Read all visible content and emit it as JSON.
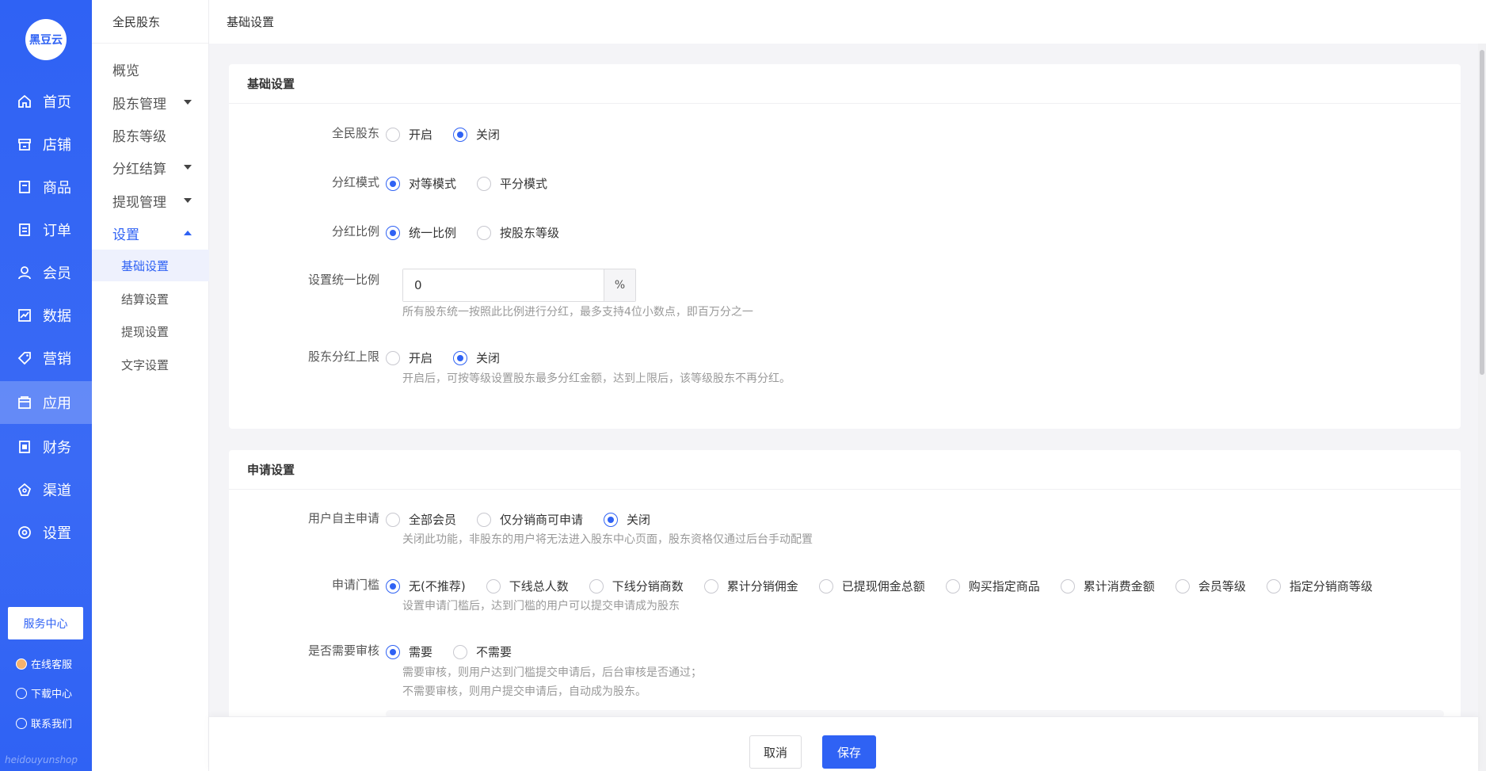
{
  "brand": {
    "logo_text": "黑豆云",
    "watermark": "heidouyunshop"
  },
  "nav": {
    "items": [
      {
        "label": "首页",
        "icon": "home-icon"
      },
      {
        "label": "店铺",
        "icon": "store-icon"
      },
      {
        "label": "商品",
        "icon": "goods-icon"
      },
      {
        "label": "订单",
        "icon": "order-icon"
      },
      {
        "label": "会员",
        "icon": "member-icon"
      },
      {
        "label": "数据",
        "icon": "chart-icon"
      },
      {
        "label": "营销",
        "icon": "tag-icon"
      },
      {
        "label": "应用",
        "icon": "app-icon"
      },
      {
        "label": "财务",
        "icon": "finance-icon"
      },
      {
        "label": "渠道",
        "icon": "channel-icon"
      },
      {
        "label": "设置",
        "icon": "gear-icon"
      }
    ],
    "active_index": 7,
    "service_button": "服务中心",
    "links": [
      "在线客服",
      "下载中心",
      "联系我们"
    ]
  },
  "subnav": {
    "title": "全民股东",
    "items": [
      "概览",
      "股东管理",
      "股东等级",
      "分红结算",
      "提现管理",
      "设置"
    ],
    "children": [
      "基础设置",
      "结算设置",
      "提现设置",
      "文字设置"
    ],
    "active_child": 0
  },
  "topbar": {
    "title": "基础设置"
  },
  "basic": {
    "title": "基础设置",
    "rows": {
      "shareholder": {
        "label": "全民股东",
        "options": [
          "开启",
          "关闭"
        ],
        "selected": 1
      },
      "bonus_mode": {
        "label": "分红模式",
        "options": [
          "对等模式",
          "平分模式"
        ],
        "selected": 0
      },
      "bonus_ratio": {
        "label": "分红比例",
        "options": [
          "统一比例",
          "按股东等级"
        ],
        "selected": 0
      },
      "uniform_ratio": {
        "label": "设置统一比例",
        "value": "0",
        "suffix": "%",
        "hint": "所有股东统一按照此比例进行分红，最多支持4位小数点，即百万分之一"
      },
      "bonus_cap": {
        "label": "股东分红上限",
        "options": [
          "开启",
          "关闭"
        ],
        "selected": 1,
        "hint": "开启后，可按等级设置股东最多分红金额，达到上限后，该等级股东不再分红。"
      }
    }
  },
  "apply": {
    "title": "申请设置",
    "rows": {
      "self_apply": {
        "label": "用户自主申请",
        "options": [
          "全部会员",
          "仅分销商可申请",
          "关闭"
        ],
        "selected": 2,
        "hint": "关闭此功能，非股东的用户将无法进入股东中心页面，股东资格仅通过后台手动配置"
      },
      "threshold": {
        "label": "申请门槛",
        "options": [
          "无(不推荐)",
          "下线总人数",
          "下线分销商数",
          "累计分销佣金",
          "已提现佣金总额",
          "购买指定商品",
          "累计消费金额",
          "会员等级",
          "指定分销商等级"
        ],
        "selected": 0,
        "hint": "设置申请门槛后，达到门槛的用户可以提交申请成为股东"
      },
      "review": {
        "label": "是否需要审核",
        "options": [
          "需要",
          "不需要"
        ],
        "selected": 0,
        "hint1": "需要审核，则用户达到门槛提交申请后，后台审核是否通过；",
        "hint2": "不需要审核，则用户提交申请后，自动成为股东。"
      }
    }
  },
  "footer": {
    "cancel": "取消",
    "save": "保存"
  }
}
